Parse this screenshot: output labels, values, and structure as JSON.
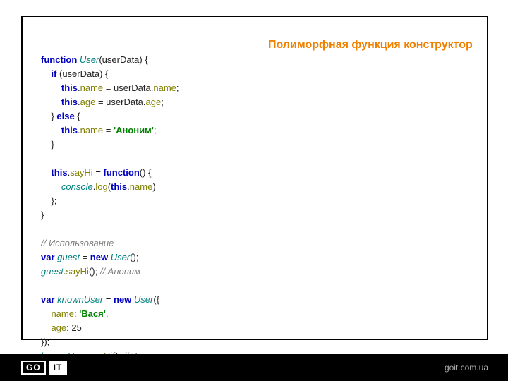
{
  "title": "Полиморфная функция конструктор",
  "code": {
    "l1a": "function",
    "l1b": " User",
    "l1c": "(userData) {",
    "l2a": "    if",
    "l2b": " (userData) {",
    "l3a": "        this",
    "l3b": ".",
    "l3c": "name",
    "l3d": " = userData.",
    "l3e": "name",
    "l3f": ";",
    "l4a": "        this",
    "l4b": ".",
    "l4c": "age",
    "l4d": " = userData.",
    "l4e": "age",
    "l4f": ";",
    "l5a": "    } ",
    "l5b": "else",
    "l5c": " {",
    "l6a": "        this",
    "l6b": ".",
    "l6c": "name",
    "l6d": " = ",
    "l6e": "'Аноним'",
    "l6f": ";",
    "l7": "    }",
    "l8": " ",
    "l9a": "    this",
    "l9b": ".",
    "l9c": "sayHi",
    "l9d": " = ",
    "l9e": "function",
    "l9f": "() {",
    "l10a": "        console",
    "l10b": ".",
    "l10c": "log",
    "l10d": "(",
    "l10e": "this",
    "l10f": ".",
    "l10g": "name",
    "l10h": ")",
    "l11": "    };",
    "l12": "}",
    "l13": " ",
    "l14": "// Использование",
    "l15a": "var",
    "l15b": " guest",
    "l15c": " = ",
    "l15d": "new",
    "l15e": " User",
    "l15f": "();",
    "l16a": "guest",
    "l16b": ".",
    "l16c": "sayHi",
    "l16d": "(); ",
    "l16e": "// Аноним",
    "l17": " ",
    "l18a": "var",
    "l18b": " knownUser",
    "l18c": " = ",
    "l18d": "new",
    "l18e": " User",
    "l18f": "({",
    "l19a": "    name",
    "l19b": ": ",
    "l19c": "'Вася'",
    "l19d": ",",
    "l20a": "    age",
    "l20b": ": ",
    "l20c": "25",
    "l21": "});",
    "l22a": "knownUser",
    "l22b": ".",
    "l22c": "sayHi",
    "l22d": "(); ",
    "l22e": "// Вася"
  },
  "logo": {
    "go": "GO",
    "it": "IT"
  },
  "footer_url": "goit.com.ua"
}
